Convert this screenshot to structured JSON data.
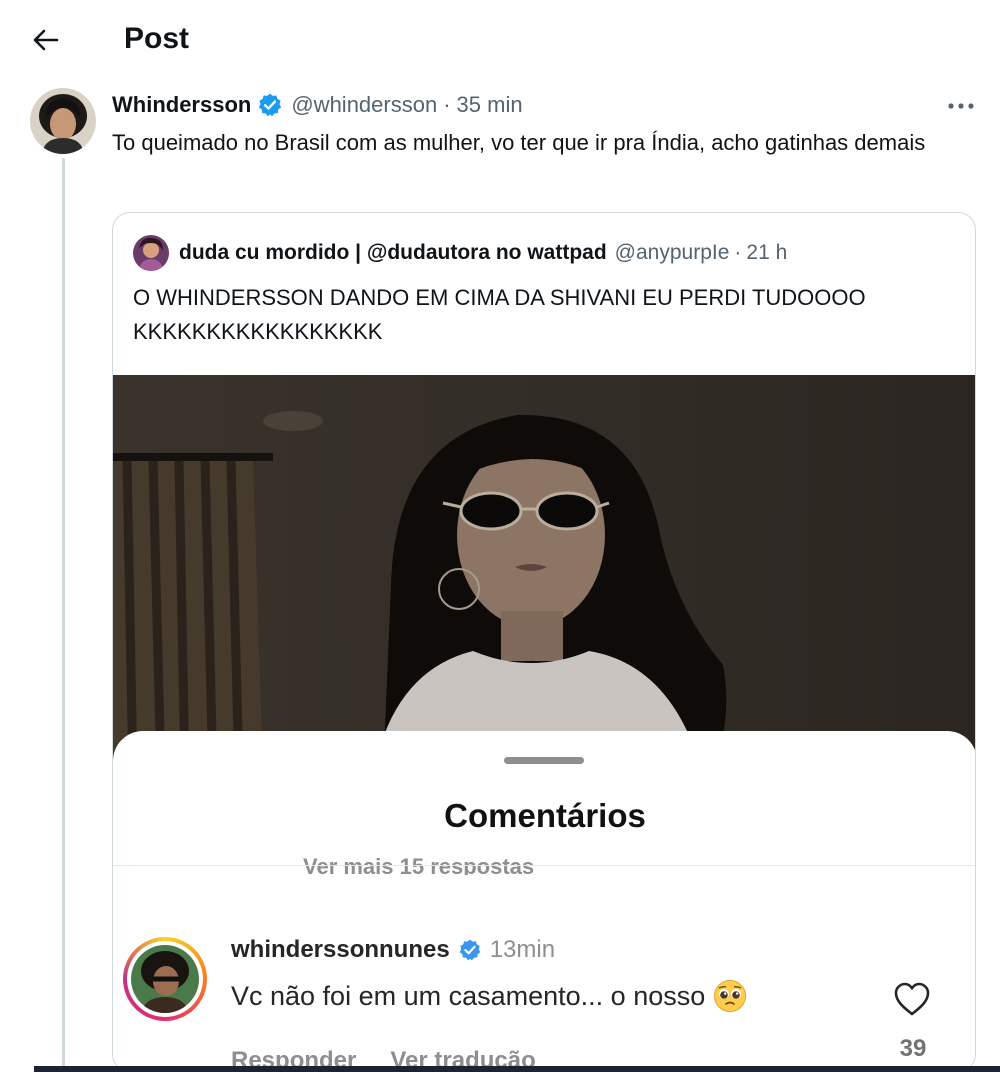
{
  "header": {
    "title": "Post",
    "back_icon": "arrow-left-icon"
  },
  "tweet": {
    "name": "Whindersson",
    "handle": "@whindersson",
    "separator": "·",
    "time": "35 min",
    "text": "To queimado no Brasil com as mulher, vo ter que ir pra Índia, acho gatinhas demais",
    "verified_color": "#1d9bf0"
  },
  "quote": {
    "name": "duda cu mordido | @dudautora no wattpad",
    "handle": "@anypurpIe",
    "separator": "·",
    "time": "21 h",
    "text": "O WHINDERSSON DANDO EM CIMA DA SHIVANI EU PERDI TUDOOOO KKKKKKKKKKKKKKKKK"
  },
  "comments_sheet": {
    "title": "Comentários",
    "more_replies": "Ver mais 15 respostas",
    "comment": {
      "user": "whinderssonnunes",
      "time": "13min",
      "text": "Vc não foi em um casamento... o nosso",
      "emoji": "pleading-face",
      "reply_label": "Responder",
      "translate_label": "Ver tradução",
      "likes": "39"
    }
  },
  "colors": {
    "accent": "#1d9bf0",
    "text": "#0f1419",
    "muted": "#536471",
    "border": "#cfd9de"
  }
}
